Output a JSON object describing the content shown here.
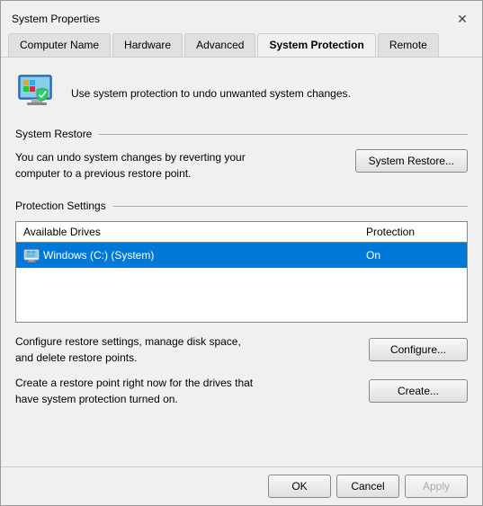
{
  "window": {
    "title": "System Properties",
    "close_label": "✕"
  },
  "tabs": [
    {
      "id": "computer-name",
      "label": "Computer Name",
      "active": false
    },
    {
      "id": "hardware",
      "label": "Hardware",
      "active": false
    },
    {
      "id": "advanced",
      "label": "Advanced",
      "active": false
    },
    {
      "id": "system-protection",
      "label": "System Protection",
      "active": true
    },
    {
      "id": "remote",
      "label": "Remote",
      "active": false
    }
  ],
  "header": {
    "description": "Use system protection to undo unwanted system changes."
  },
  "system_restore": {
    "section_label": "System Restore",
    "text": "You can undo system changes by reverting your computer to a previous restore point.",
    "button_label": "System Restore..."
  },
  "protection_settings": {
    "section_label": "Protection Settings",
    "table": {
      "col_drive": "Available Drives",
      "col_protection": "Protection",
      "rows": [
        {
          "drive": "Windows (C:) (System)",
          "protection": "On",
          "selected": true
        }
      ]
    },
    "configure_text": "Configure restore settings, manage disk space, and delete restore points.",
    "configure_btn": "Configure...",
    "create_text": "Create a restore point right now for the drives that have system protection turned on.",
    "create_btn": "Create..."
  },
  "bottom_bar": {
    "ok_label": "OK",
    "cancel_label": "Cancel",
    "apply_label": "Apply"
  }
}
